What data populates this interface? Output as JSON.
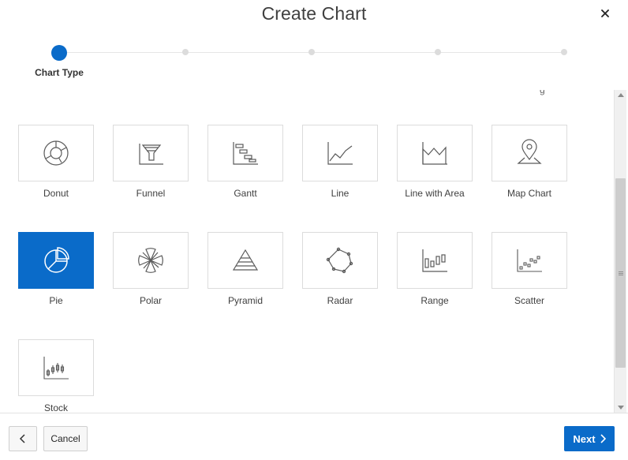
{
  "dialog": {
    "title": "Create Chart",
    "close_icon": "close-icon"
  },
  "wizard": {
    "steps": [
      "Chart Type",
      "",
      "",
      "",
      "",
      "",
      ""
    ],
    "active_step_label": "Chart Type",
    "active_color": "#0a6bc9"
  },
  "chart_types": {
    "top_cut_text": "g",
    "items": [
      {
        "label": "Donut",
        "icon": "donut-chart-icon",
        "selected": false
      },
      {
        "label": "Funnel",
        "icon": "funnel-chart-icon",
        "selected": false
      },
      {
        "label": "Gantt",
        "icon": "gantt-chart-icon",
        "selected": false
      },
      {
        "label": "Line",
        "icon": "line-chart-icon",
        "selected": false
      },
      {
        "label": "Line with Area",
        "icon": "area-chart-icon",
        "selected": false
      },
      {
        "label": "Map Chart",
        "icon": "map-pin-icon",
        "selected": false
      },
      {
        "label": "Pie",
        "icon": "pie-chart-icon",
        "selected": true
      },
      {
        "label": "Polar",
        "icon": "polar-chart-icon",
        "selected": false
      },
      {
        "label": "Pyramid",
        "icon": "pyramid-chart-icon",
        "selected": false
      },
      {
        "label": "Radar",
        "icon": "radar-chart-icon",
        "selected": false
      },
      {
        "label": "Range",
        "icon": "range-chart-icon",
        "selected": false
      },
      {
        "label": "Scatter",
        "icon": "scatter-chart-icon",
        "selected": false
      },
      {
        "label": "Stock",
        "icon": "stock-chart-icon",
        "selected": false
      }
    ]
  },
  "footer": {
    "back_icon": "chevron-left-icon",
    "cancel_label": "Cancel",
    "next_label": "Next",
    "next_icon": "chevron-right-icon"
  },
  "colors": {
    "accent": "#0a6bc9",
    "tile_border": "#dcdcdc",
    "icon_stroke": "#5a5a5a"
  }
}
